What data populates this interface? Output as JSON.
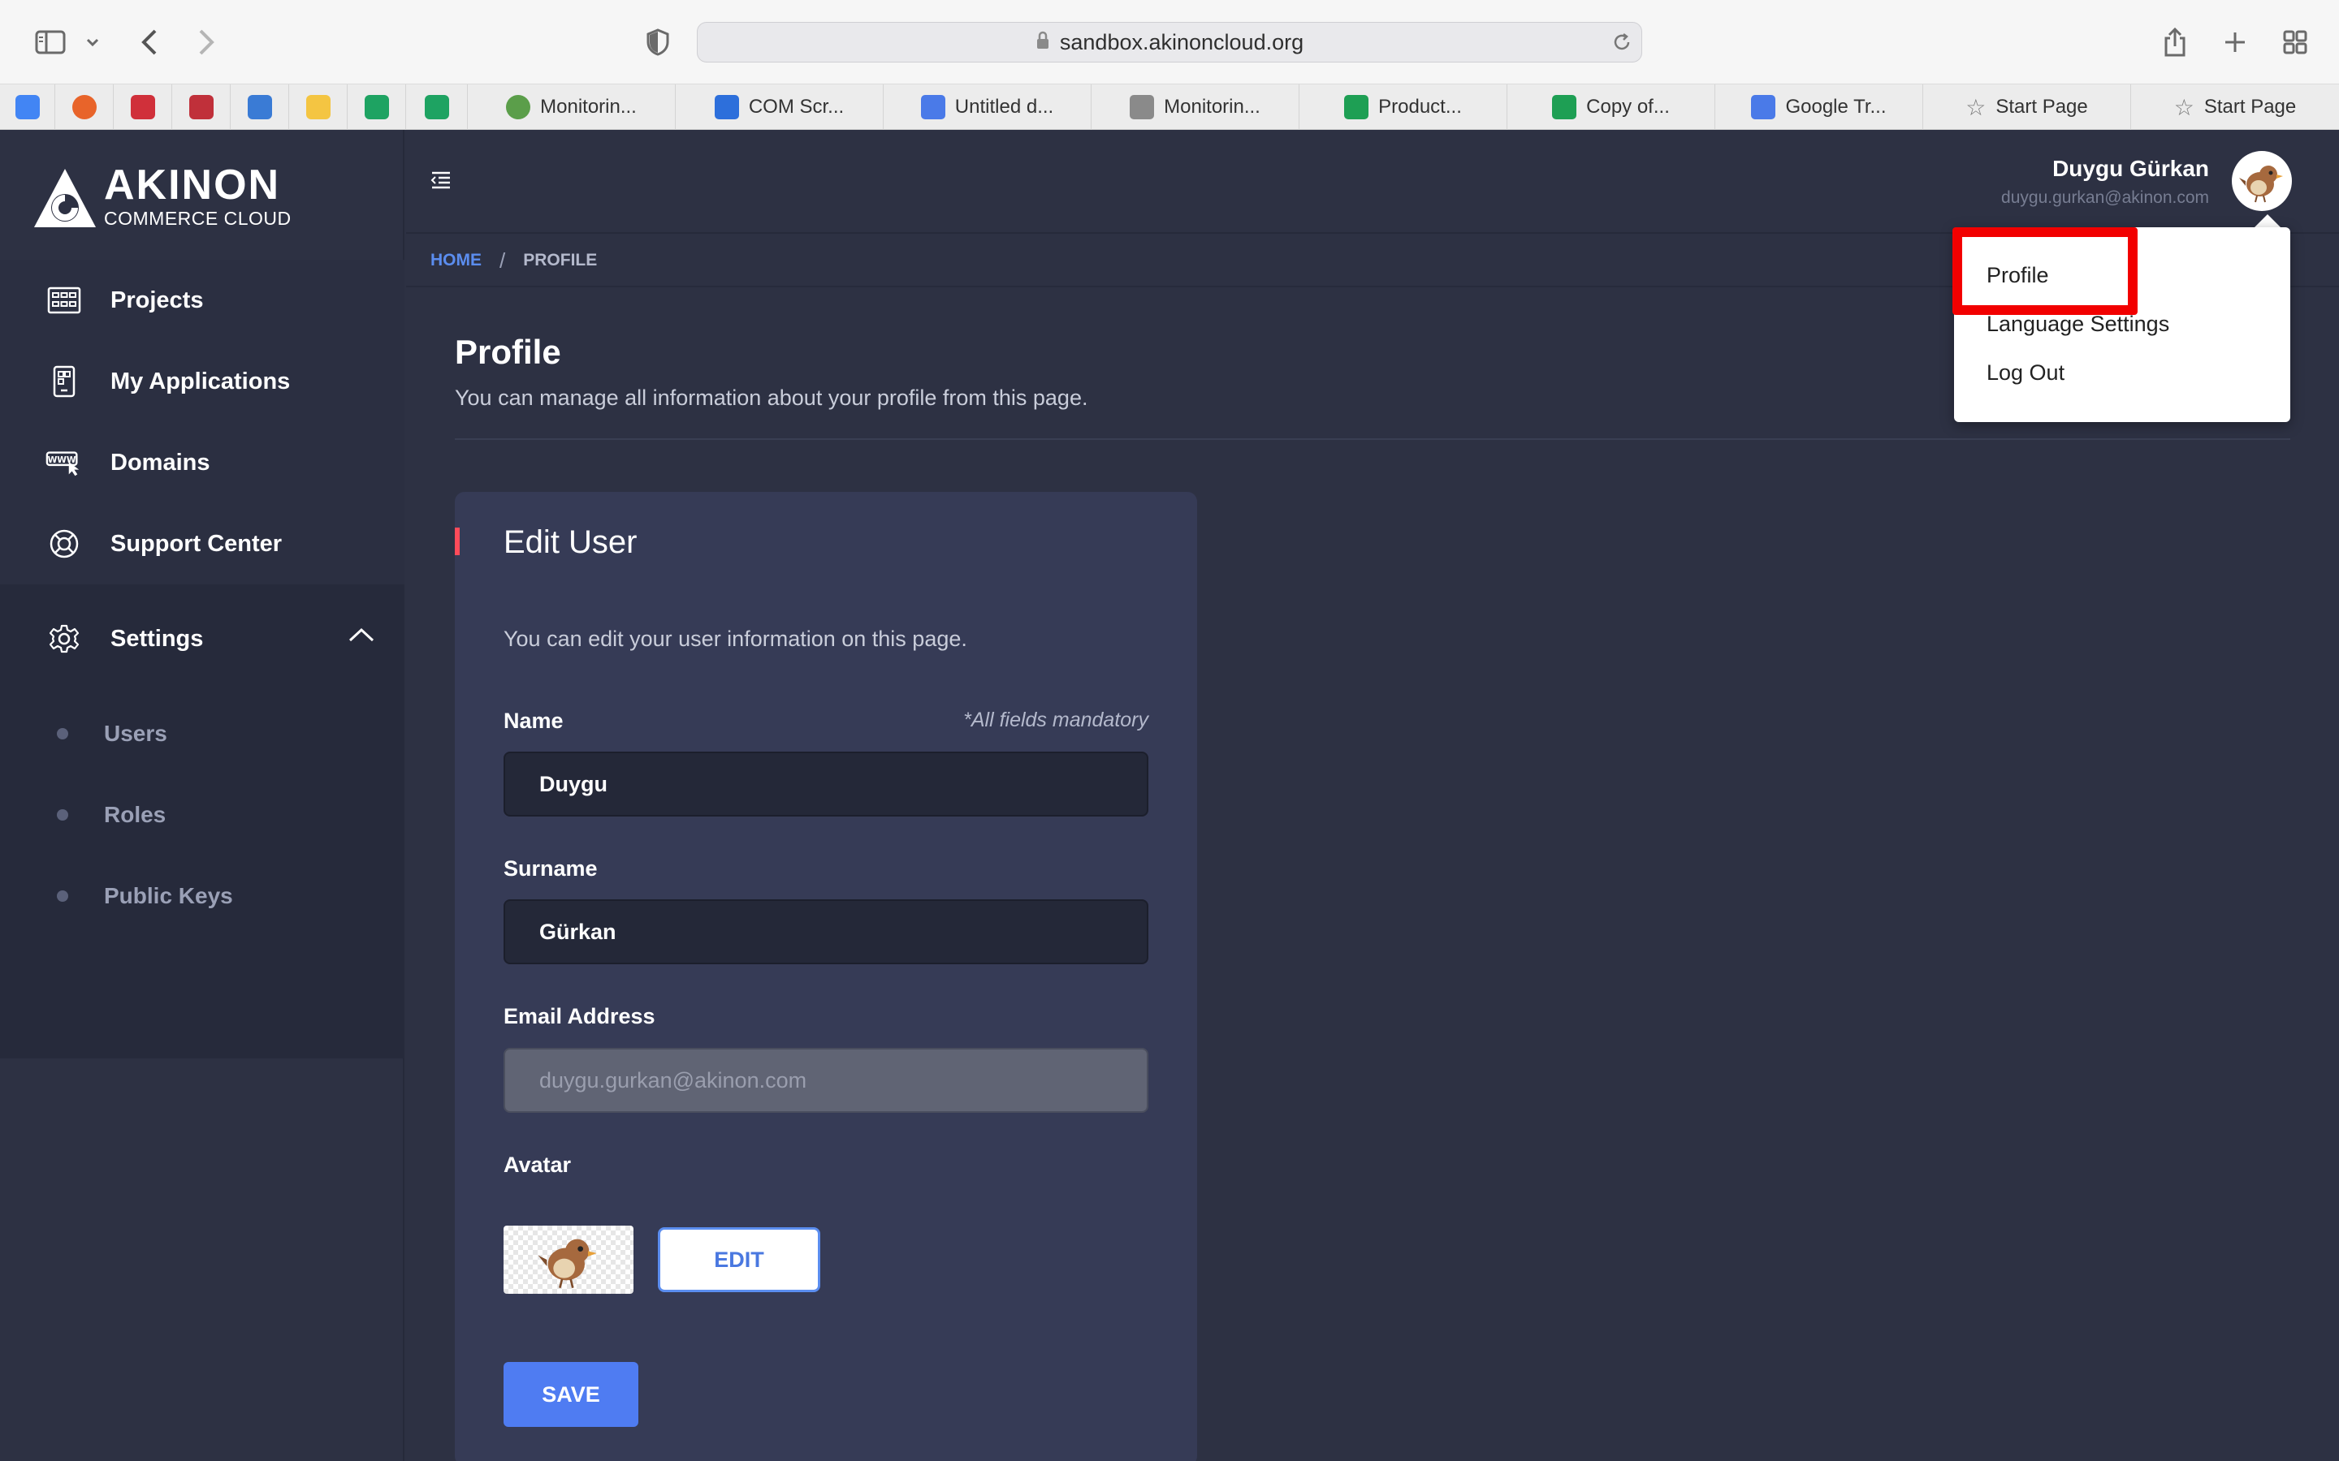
{
  "browser": {
    "url": "sandbox.akinoncloud.org",
    "bookmarks": [
      {
        "label": "Monitorin...",
        "color": "#5b9e4a"
      },
      {
        "label": "COM Scr...",
        "color": "#2d6fdb"
      },
      {
        "label": "Untitled d...",
        "color": "#4a7ae8"
      },
      {
        "label": "Monitorin...",
        "color": "#8a8a8a"
      },
      {
        "label": "Product...",
        "color": "#1e9f54"
      },
      {
        "label": "Copy of...",
        "color": "#1e9f54"
      },
      {
        "label": "Google Tr...",
        "color": "#4a7ae8"
      },
      {
        "label": "Start Page",
        "color": "#7a7a7a"
      },
      {
        "label": "Start Page",
        "color": "#7a7a7a"
      }
    ],
    "favicons": [
      "#4285f4",
      "#e8642a",
      "#d0303a",
      "#c0303a",
      "#3a7bd5",
      "#f4c542",
      "#1ea362",
      "#1ea362"
    ]
  },
  "logo": {
    "brand": "AKINON",
    "tagline": "COMMERCE CLOUD"
  },
  "sidebar": {
    "items": [
      {
        "label": "Projects",
        "icon": "grid-icon"
      },
      {
        "label": "My Applications",
        "icon": "app-icon"
      },
      {
        "label": "Domains",
        "icon": "www-icon"
      },
      {
        "label": "Support Center",
        "icon": "lifebuoy-icon"
      }
    ],
    "settings": {
      "label": "Settings",
      "icon": "gear-icon",
      "subitems": [
        {
          "label": "Users"
        },
        {
          "label": "Roles"
        },
        {
          "label": "Public Keys"
        }
      ]
    }
  },
  "breadcrumb": {
    "home": "HOME",
    "separator": "/",
    "current": "PROFILE"
  },
  "page": {
    "title": "Profile",
    "subtitle": "You can manage all information about your profile from this page."
  },
  "card": {
    "title": "Edit User",
    "description": "You can edit your user information on this page.",
    "mandatory_note": "*All fields mandatory",
    "fields": {
      "name": {
        "label": "Name",
        "value": "Duygu"
      },
      "surname": {
        "label": "Surname",
        "value": "Gürkan"
      },
      "email": {
        "label": "Email Address",
        "placeholder": "duygu.gurkan@akinon.com"
      },
      "avatar": {
        "label": "Avatar"
      }
    },
    "edit_label": "EDIT",
    "save_label": "SAVE"
  },
  "user": {
    "name": "Duygu Gürkan",
    "email": "duygu.gurkan@akinon.com"
  },
  "dropdown": {
    "items": [
      {
        "label": "Profile"
      },
      {
        "label": "Language Settings"
      },
      {
        "label": "Log Out"
      }
    ]
  },
  "colors": {
    "accent": "#4f7cf2",
    "highlight": "#f20000",
    "sidebar_bg": "#2d3143",
    "card_bg": "#363b56"
  }
}
